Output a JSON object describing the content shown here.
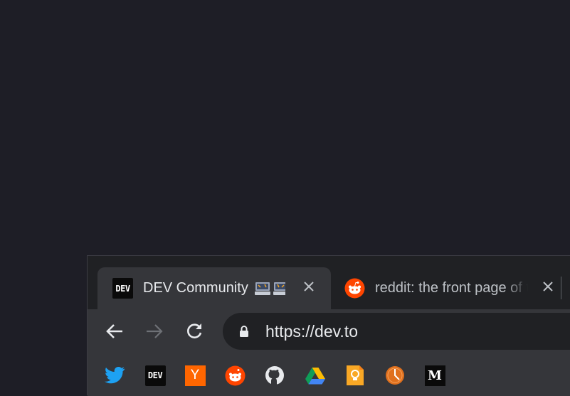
{
  "tabs": [
    {
      "title": "DEV Community",
      "favicon": "DEV",
      "active": true
    },
    {
      "title": "reddit: the front page of the internet",
      "favicon": "reddit-icon",
      "active": false
    }
  ],
  "omnibox": {
    "url": "https://dev.to"
  },
  "bookmarks": [
    {
      "name": "twitter-icon"
    },
    {
      "name": "dev-icon",
      "label": "DEV"
    },
    {
      "name": "hacker-news-icon",
      "label": "Y"
    },
    {
      "name": "reddit-icon"
    },
    {
      "name": "github-icon"
    },
    {
      "name": "google-drive-icon"
    },
    {
      "name": "keep-icon"
    },
    {
      "name": "producthunt-icon"
    },
    {
      "name": "medium-icon",
      "label": "M"
    }
  ],
  "colors": {
    "background": "#1e1e26",
    "tabstrip": "#202124",
    "toolbar": "#35363a",
    "reddit": "#ff4500",
    "hn": "#ff6600",
    "twitter": "#1da1f2"
  }
}
